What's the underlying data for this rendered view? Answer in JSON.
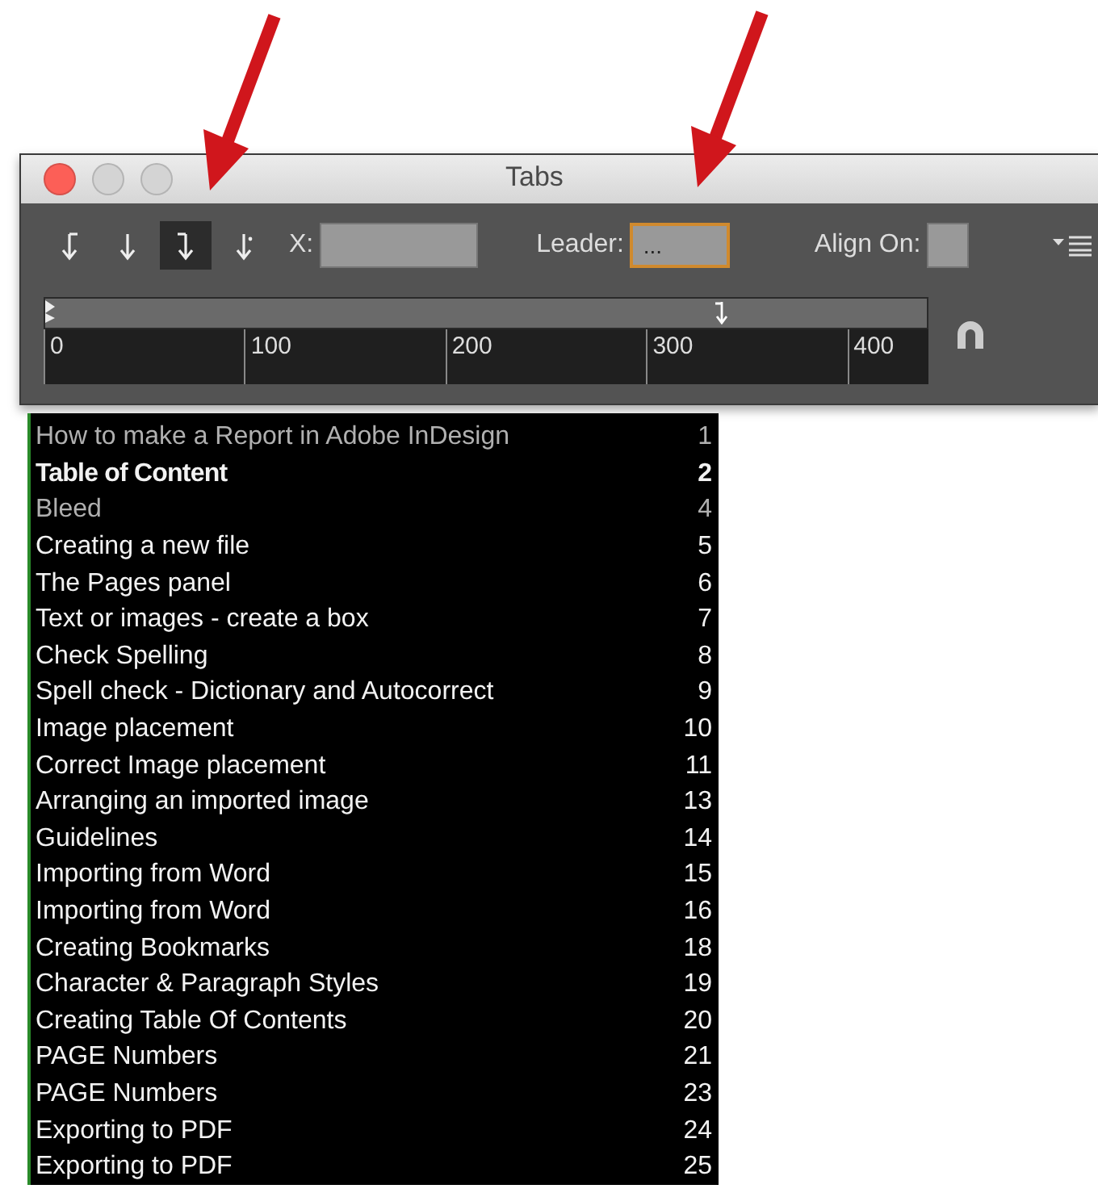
{
  "window": {
    "title": "Tabs"
  },
  "tab_buttons": [
    {
      "kind": "left",
      "selected": false
    },
    {
      "kind": "center",
      "selected": false
    },
    {
      "kind": "right",
      "selected": true
    },
    {
      "kind": "decimal",
      "selected": false
    }
  ],
  "x_field": {
    "label": "X:"
  },
  "leader_field": {
    "label": "Leader:",
    "value": "...",
    "focused": true
  },
  "align_on_field": {
    "label": "Align On:"
  },
  "ruler": {
    "ticks": [
      "0",
      "100",
      "200",
      "300",
      "400"
    ]
  },
  "toc_entries": [
    {
      "title": "How to make a Report in Adobe InDesign",
      "page": "1",
      "kind": "dim"
    },
    {
      "title": "Table of Content",
      "page": "2",
      "kind": "bold"
    },
    {
      "title": "Bleed",
      "page": "4",
      "kind": "dim"
    },
    {
      "title": "Creating a new file",
      "page": "5",
      "kind": "normal"
    },
    {
      "title": "The Pages panel",
      "page": "6",
      "kind": "normal"
    },
    {
      "title": "Text or images - create a box",
      "page": "7",
      "kind": "normal"
    },
    {
      "title": "Check Spelling",
      "page": "8",
      "kind": "normal"
    },
    {
      "title": "Spell check - Dictionary and Autocorrect",
      "page": "9",
      "kind": "normal"
    },
    {
      "title": "Image placement",
      "page": "10",
      "kind": "normal"
    },
    {
      "title": "Correct Image placement",
      "page": "11",
      "kind": "normal"
    },
    {
      "title": "Arranging an imported image",
      "page": "13",
      "kind": "normal"
    },
    {
      "title": "Guidelines",
      "page": "14",
      "kind": "normal"
    },
    {
      "title": "Importing from Word",
      "page": "15",
      "kind": "normal"
    },
    {
      "title": "Importing from Word",
      "page": "16",
      "kind": "normal"
    },
    {
      "title": "Creating Bookmarks",
      "page": "18",
      "kind": "normal"
    },
    {
      "title": "Character & Paragraph Styles",
      "page": "19",
      "kind": "normal"
    },
    {
      "title": "Creating Table Of Contents",
      "page": "20",
      "kind": "normal"
    },
    {
      "title": "PAGE Numbers",
      "page": "21",
      "kind": "normal"
    },
    {
      "title": "PAGE Numbers",
      "page": "23",
      "kind": "normal"
    },
    {
      "title": "Exporting to PDF",
      "page": "24",
      "kind": "normal"
    },
    {
      "title": "Exporting to PDF",
      "page": "25",
      "kind": "normal"
    }
  ]
}
